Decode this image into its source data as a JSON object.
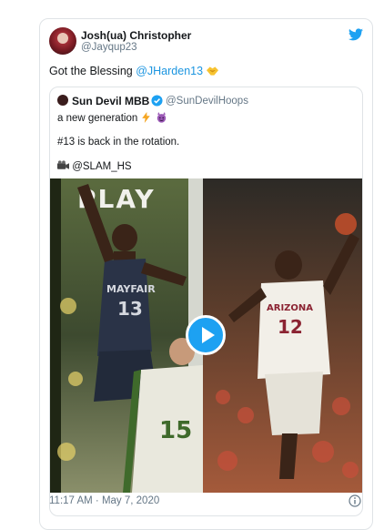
{
  "tweet": {
    "author_name": "Josh(ua) Christopher",
    "author_handle": "@Jayqup23",
    "text_prefix": "Got the Blessing ",
    "mention": "@JHarden13",
    "timestamp": "11:17 AM · May 7, 2020"
  },
  "quoted_tweet": {
    "author_name": "Sun Devil MBB",
    "author_handle": "@SunDevilHoops",
    "line1": "a new generation",
    "line2": "#13 is back in the rotation.",
    "line3_credit": "@SLAM_HS"
  },
  "video_overlay": {
    "play_text": "PLAY",
    "left_jersey_team": "MAYFAIR",
    "left_jersey_number": "13",
    "right_jersey_team": "ARIZONA",
    "right_jersey_number": "12",
    "defender_number": "15"
  },
  "colors": {
    "accent": "#1da1f2",
    "mention": "#1b95e0",
    "muted": "#657786"
  },
  "icons": [
    "twitter-bird-icon",
    "verified-badge-icon",
    "lightning-emoji",
    "devil-emoji",
    "handshake-emoji",
    "camera-emoji",
    "play-icon",
    "info-icon"
  ]
}
